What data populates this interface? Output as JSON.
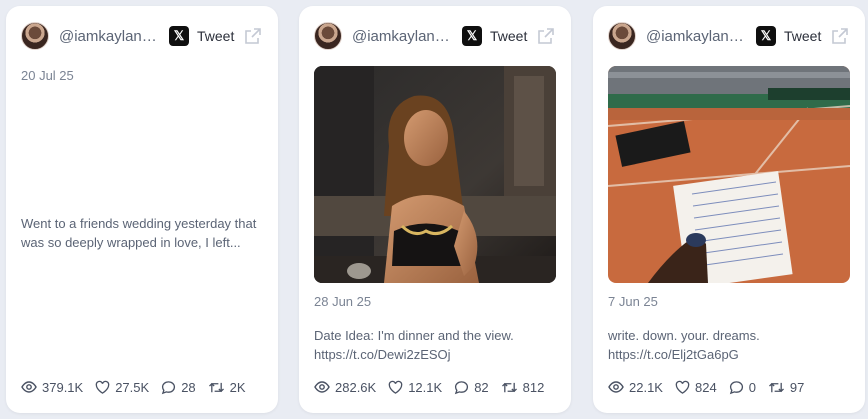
{
  "cards": [
    {
      "handle": "@iamkaylanic...",
      "source_label": "Tweet",
      "date": "20 Jul 25",
      "text": "Went to a friends wedding yesterday that was so deeply wrapped in love, I left...",
      "stats": {
        "views": "379.1K",
        "likes": "27.5K",
        "replies": "28",
        "retweets": "2K"
      }
    },
    {
      "handle": "@iamkaylanic...",
      "source_label": "Tweet",
      "date": "28 Jun 25",
      "text": "Date Idea: I'm dinner and the view. https://t.co/Dewi2zESOj",
      "stats": {
        "views": "282.6K",
        "likes": "12.1K",
        "replies": "82",
        "retweets": "812"
      }
    },
    {
      "handle": "@iamkaylanic...",
      "source_label": "Tweet",
      "date": "7 Jun 25",
      "text": "write. down. your. dreams. https://t.co/Elj2tGa6pG",
      "stats": {
        "views": "22.1K",
        "likes": "824",
        "replies": "0",
        "retweets": "97"
      }
    }
  ]
}
